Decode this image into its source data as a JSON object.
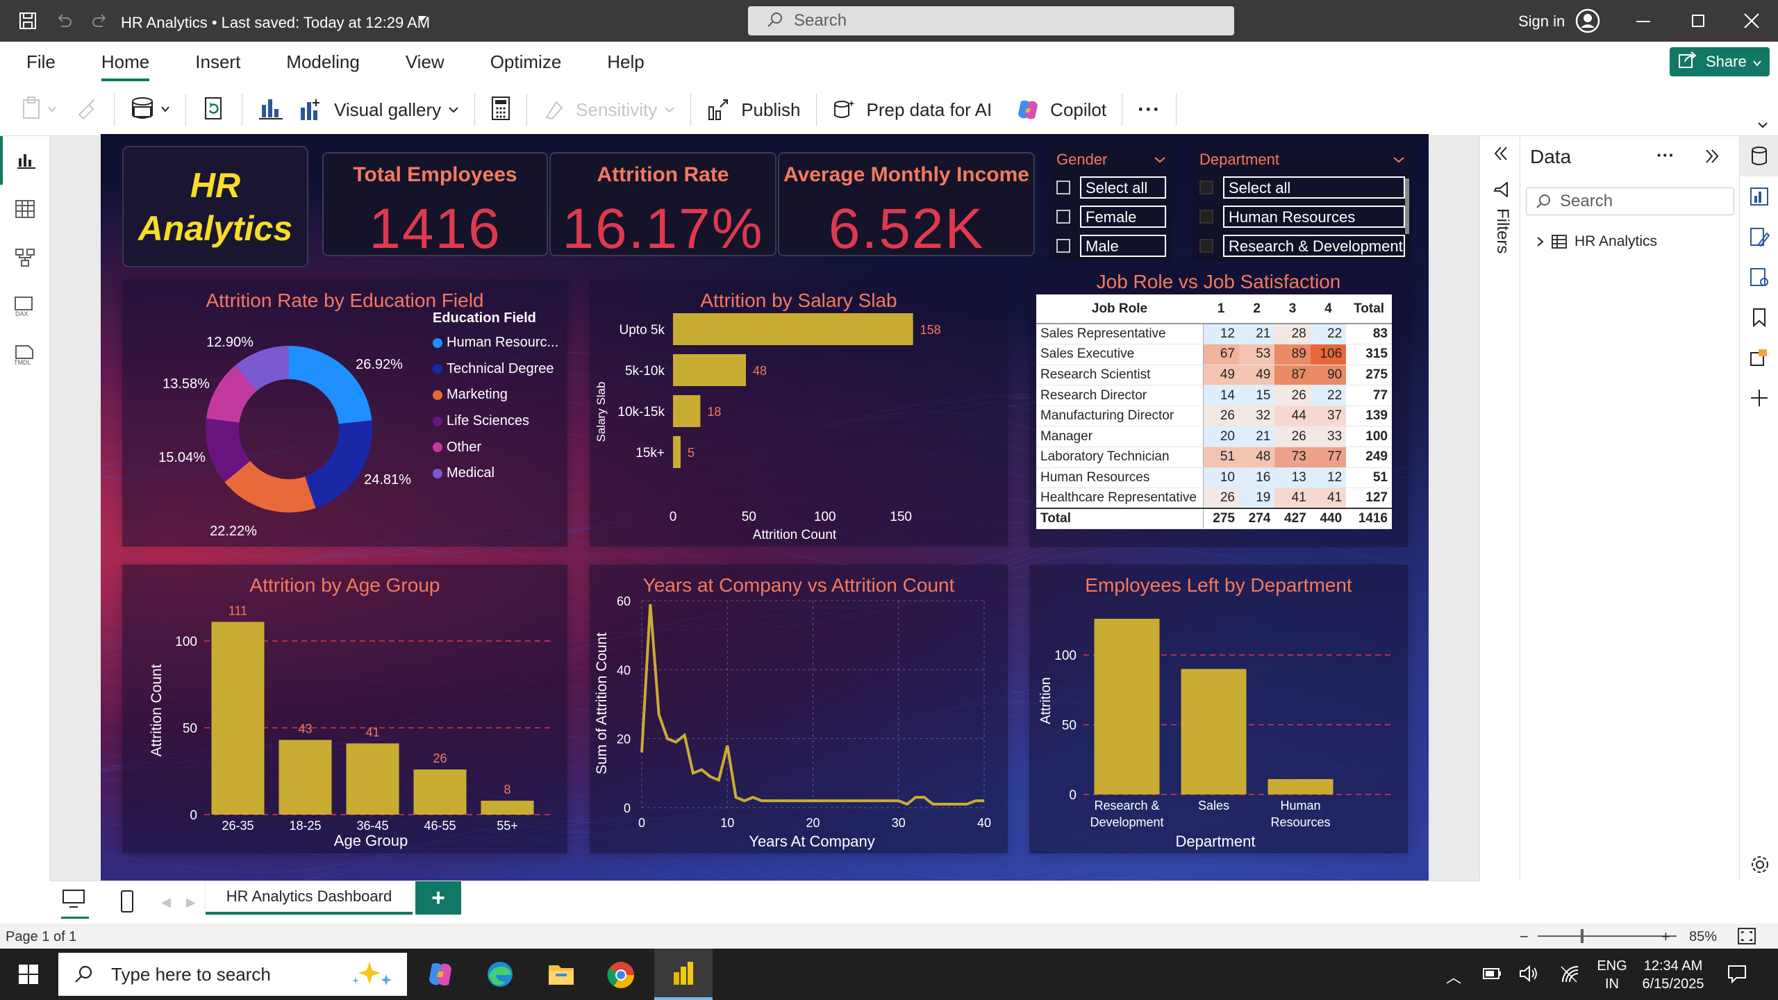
{
  "titlebar": {
    "title": "HR Analytics • Last saved: Today at 12:29 AM",
    "search_placeholder": "Search",
    "sign_in": "Sign in"
  },
  "menu": {
    "items": [
      "File",
      "Home",
      "Insert",
      "Modeling",
      "View",
      "Optimize",
      "Help"
    ],
    "active": "Home",
    "share_label": "Share"
  },
  "ribbon": {
    "visual_gallery": "Visual gallery",
    "sensitivity": "Sensitivity",
    "publish": "Publish",
    "prep_data": "Prep data for AI",
    "copilot": "Copilot",
    "more": "···"
  },
  "report": {
    "logo_line1": "HR",
    "logo_line2": "Analytics",
    "kpis": [
      {
        "title": "Total Employees",
        "value": "1416"
      },
      {
        "title": "Attrition Rate",
        "value": "16.17%"
      },
      {
        "title": "Average Monthly Income",
        "value": "6.52K"
      }
    ],
    "gender_slicer": {
      "title": "Gender",
      "items": [
        "Select all",
        "Female",
        "Male"
      ]
    },
    "department_slicer": {
      "title": "Department",
      "items": [
        "Select all",
        "Human Resources",
        "Research & Development"
      ]
    },
    "accent": "#f47a5e",
    "bar_color": "#c9ac32"
  },
  "chart_data": [
    {
      "type": "pie",
      "title": "Attrition Rate by Education Field",
      "legend_title": "Education Field",
      "legend_labels": [
        "Human Resourc...",
        "Technical Degree",
        "Marketing",
        "Life Sciences",
        "Other",
        "Medical"
      ],
      "slice_labels": [
        "26.92%",
        "24.81%",
        "22.22%",
        "15.04%",
        "13.58%",
        "12.90%"
      ],
      "values": [
        26.92,
        24.81,
        22.22,
        15.04,
        13.58,
        12.9
      ],
      "colors": [
        "#1e90ff",
        "#1a28a8",
        "#e8693a",
        "#6a1480",
        "#c23aa0",
        "#7a5ad0"
      ],
      "legend_position": "right"
    },
    {
      "type": "bar",
      "orientation": "horizontal",
      "title": "Attrition by Salary Slab",
      "categories": [
        "Upto 5k",
        "5k-10k",
        "10k-15k",
        "15k+"
      ],
      "values": [
        158,
        48,
        18,
        5
      ],
      "xlabel": "Attrition Count",
      "ylabel": "Salary Slab",
      "xticks": [
        "0",
        "50",
        "100",
        "150"
      ],
      "xlim": [
        0,
        160
      ]
    },
    {
      "type": "table",
      "title": "Job Role vs Job Satisfaction",
      "columns": [
        "Job Role",
        "1",
        "2",
        "3",
        "4",
        "Total"
      ],
      "rows": [
        [
          "Sales Representative",
          "12",
          "21",
          "28",
          "22",
          "83"
        ],
        [
          "Sales Executive",
          "67",
          "53",
          "89",
          "106",
          "315"
        ],
        [
          "Research Scientist",
          "49",
          "49",
          "87",
          "90",
          "275"
        ],
        [
          "Research Director",
          "14",
          "15",
          "26",
          "22",
          "77"
        ],
        [
          "Manufacturing Director",
          "26",
          "32",
          "44",
          "37",
          "139"
        ],
        [
          "Manager",
          "20",
          "21",
          "26",
          "33",
          "100"
        ],
        [
          "Laboratory Technician",
          "51",
          "48",
          "73",
          "77",
          "249"
        ],
        [
          "Human Resources",
          "10",
          "16",
          "13",
          "12",
          "51"
        ],
        [
          "Healthcare Representative",
          "26",
          "19",
          "41",
          "41",
          "127"
        ]
      ],
      "total": [
        "Total",
        "275",
        "274",
        "427",
        "440",
        "1416"
      ]
    },
    {
      "type": "bar",
      "title": "Attrition by Age Group",
      "categories": [
        "26-35",
        "18-25",
        "36-45",
        "46-55",
        "55+"
      ],
      "values": [
        111,
        43,
        41,
        26,
        8
      ],
      "xlabel": "Age Group",
      "ylabel": "Attrition Count",
      "yticks": [
        "0",
        "50",
        "100"
      ],
      "ylim": [
        0,
        120
      ]
    },
    {
      "type": "line",
      "title": "Years at Company vs Attrition Count",
      "x": [
        0,
        1,
        2,
        3,
        4,
        5,
        6,
        7,
        8,
        9,
        10,
        11,
        12,
        13,
        14,
        15,
        16,
        17,
        18,
        19,
        20,
        21,
        22,
        23,
        24,
        25,
        26,
        27,
        28,
        29,
        30,
        31,
        32,
        33,
        34,
        35,
        36,
        37,
        38,
        39,
        40
      ],
      "y": [
        16,
        59,
        27,
        20,
        19,
        21,
        10,
        11,
        9,
        8,
        18,
        3,
        2,
        3,
        2,
        2,
        2,
        2,
        2,
        2,
        2,
        2,
        2,
        2,
        2,
        2,
        2,
        2,
        2,
        2,
        2,
        1,
        3,
        3,
        1,
        1,
        1,
        1,
        1,
        2,
        2
      ],
      "xlabel": "Years At Company",
      "ylabel": "Sum of Attrition Count",
      "xticks": [
        "0",
        "10",
        "20",
        "30",
        "40"
      ],
      "yticks": [
        "0",
        "20",
        "40",
        "60"
      ],
      "xlim": [
        0,
        40
      ],
      "ylim": [
        0,
        60
      ]
    },
    {
      "type": "bar",
      "title": "Employees Left by Department",
      "categories": [
        "Research & Development",
        "Sales",
        "Human Resources"
      ],
      "category_lines": [
        [
          "Research &",
          "Development"
        ],
        [
          "Sales"
        ],
        [
          "Human",
          "Resources"
        ]
      ],
      "values": [
        126,
        90,
        11
      ],
      "xlabel": "Department",
      "ylabel": "Attrition",
      "yticks": [
        "0",
        "50",
        "100"
      ],
      "ylim": [
        0,
        130
      ]
    }
  ],
  "data_pane": {
    "title": "Data",
    "search_placeholder": "Search",
    "tree_item": "HR Analytics",
    "filters_label": "Filters"
  },
  "pages": {
    "tab": "HR Analytics Dashboard",
    "add": "+"
  },
  "status": {
    "page": "Page 1 of 1",
    "zoom": "85%"
  },
  "taskbar": {
    "search_placeholder": "Type here to search",
    "lang1": "ENG",
    "lang2": "IN",
    "time": "12:34 AM",
    "date": "6/15/2025"
  }
}
